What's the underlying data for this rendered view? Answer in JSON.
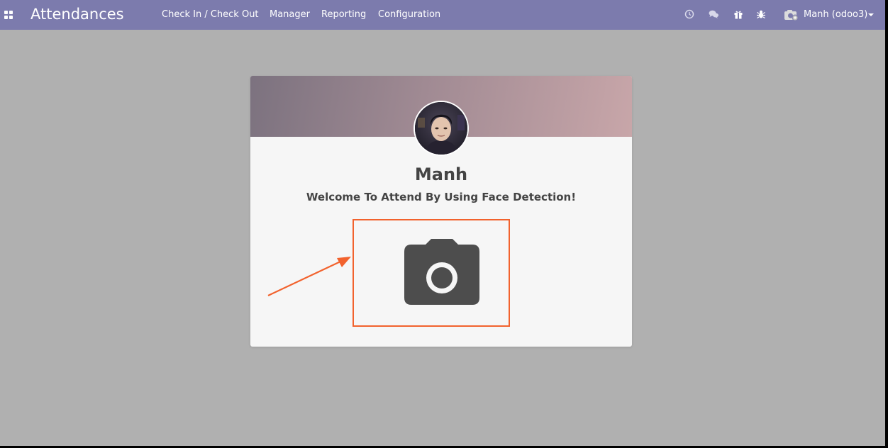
{
  "navbar": {
    "app_title": "Attendances",
    "menu": [
      {
        "label": "Check In / Check Out"
      },
      {
        "label": "Manager"
      },
      {
        "label": "Reporting"
      },
      {
        "label": "Configuration"
      }
    ],
    "user_label": "Manh (odoo3)",
    "system_icons": [
      "clock-icon",
      "chat-icon",
      "gift-icon",
      "bug-icon"
    ]
  },
  "card": {
    "employee_name": "Manh",
    "welcome": "Welcome To Attend By Using Face Detection!",
    "action_icon": "camera-icon"
  },
  "colors": {
    "navbar": "#7c7bad",
    "background": "#b0b0b0",
    "card": "#f6f6f6",
    "text": "#444444",
    "annotation": "#f2622d"
  }
}
